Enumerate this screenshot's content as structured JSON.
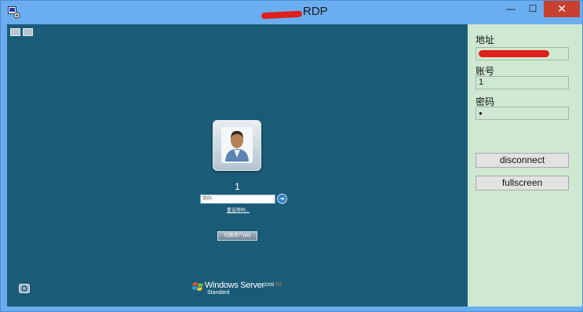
{
  "window": {
    "title": "RDP",
    "controls": {
      "minimize": "—",
      "maximize": "☐",
      "close": "✕"
    }
  },
  "remote": {
    "user_name": "1",
    "password_placeholder": "密码",
    "reset_password": "重设密码...",
    "switch_user": "切换用户(W)",
    "branding": {
      "product": "Windows Server",
      "version_prefix": "2008",
      "version_suffix": "R2",
      "edition": "Standard"
    }
  },
  "panel": {
    "address_label": "地址",
    "address_value": "",
    "account_label": "账号",
    "account_value": "1",
    "password_label": "密码",
    "password_value": "●",
    "disconnect_label": "disconnect",
    "fullscreen_label": "fullscreen"
  },
  "colors": {
    "titlebar": "#6aaef0",
    "close": "#c7402f",
    "remote_bg": "#1a5b78",
    "panel_bg": "#cfe8d1"
  }
}
